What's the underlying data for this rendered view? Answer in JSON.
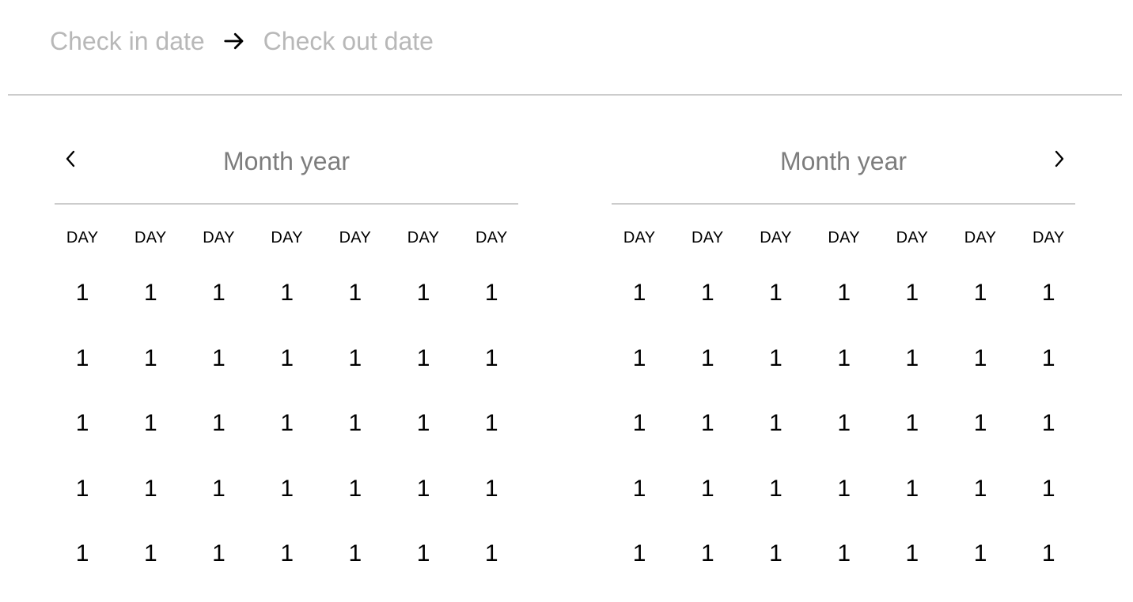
{
  "search": {
    "check_in_placeholder": "Check in date",
    "check_out_placeholder": "Check out date",
    "separator_icon": "arrow-right-icon"
  },
  "calendar": {
    "months": [
      {
        "title": "Month year",
        "nav_icon": "chevron-left-icon",
        "weekdays": [
          "DAY",
          "DAY",
          "DAY",
          "DAY",
          "DAY",
          "DAY",
          "DAY"
        ],
        "weeks": [
          [
            "1",
            "1",
            "1",
            "1",
            "1",
            "1",
            "1"
          ],
          [
            "1",
            "1",
            "1",
            "1",
            "1",
            "1",
            "1"
          ],
          [
            "1",
            "1",
            "1",
            "1",
            "1",
            "1",
            "1"
          ],
          [
            "1",
            "1",
            "1",
            "1",
            "1",
            "1",
            "1"
          ],
          [
            "1",
            "1",
            "1",
            "1",
            "1",
            "1",
            "1"
          ]
        ]
      },
      {
        "title": "Month year",
        "nav_icon": "chevron-right-icon",
        "weekdays": [
          "DAY",
          "DAY",
          "DAY",
          "DAY",
          "DAY",
          "DAY",
          "DAY"
        ],
        "weeks": [
          [
            "1",
            "1",
            "1",
            "1",
            "1",
            "1",
            "1"
          ],
          [
            "1",
            "1",
            "1",
            "1",
            "1",
            "1",
            "1"
          ],
          [
            "1",
            "1",
            "1",
            "1",
            "1",
            "1",
            "1"
          ],
          [
            "1",
            "1",
            "1",
            "1",
            "1",
            "1",
            "1"
          ],
          [
            "1",
            "1",
            "1",
            "1",
            "1",
            "1",
            "1"
          ]
        ]
      }
    ]
  },
  "colors": {
    "placeholder": "#b8b8b8",
    "month_title": "#7d7d7d",
    "divider": "#cccccc",
    "text": "#000000"
  }
}
